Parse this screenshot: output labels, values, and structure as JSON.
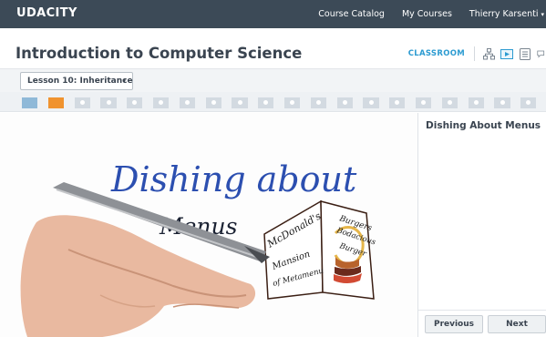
{
  "header": {
    "brand": "UDACITY",
    "nav": [
      "Course Catalog",
      "My Courses",
      "Thierry Karsenti"
    ],
    "user_caret": "▾"
  },
  "course": {
    "title": "Introduction to Computer Science",
    "classroom_label": "CLASSROOM",
    "icons": [
      "sitemap-icon",
      "video-icon",
      "notes-icon",
      "forum-icon"
    ]
  },
  "lesson": {
    "selected": "Lesson 10: Inheritance",
    "caret": "▾"
  },
  "progress": {
    "completed_segments": 1,
    "current_segment": 2,
    "total_segments": 20
  },
  "video": {
    "handwriting_line1": "Dishing about",
    "handwriting_line2": "Menus",
    "menu_left_text": [
      "McDonald's",
      "Mansion",
      "of Metamenu"
    ],
    "menu_right_text": [
      "Burgers",
      "Bodacious",
      "Burger"
    ]
  },
  "sidebar": {
    "title": "Dishing About Menus",
    "previous_label": "Previous",
    "next_label": "Next"
  },
  "colors": {
    "topbar": "#3c4a57",
    "accent": "#2c9bd1",
    "progress_current": "#f0932f",
    "progress_done": "#8fb9d8"
  }
}
